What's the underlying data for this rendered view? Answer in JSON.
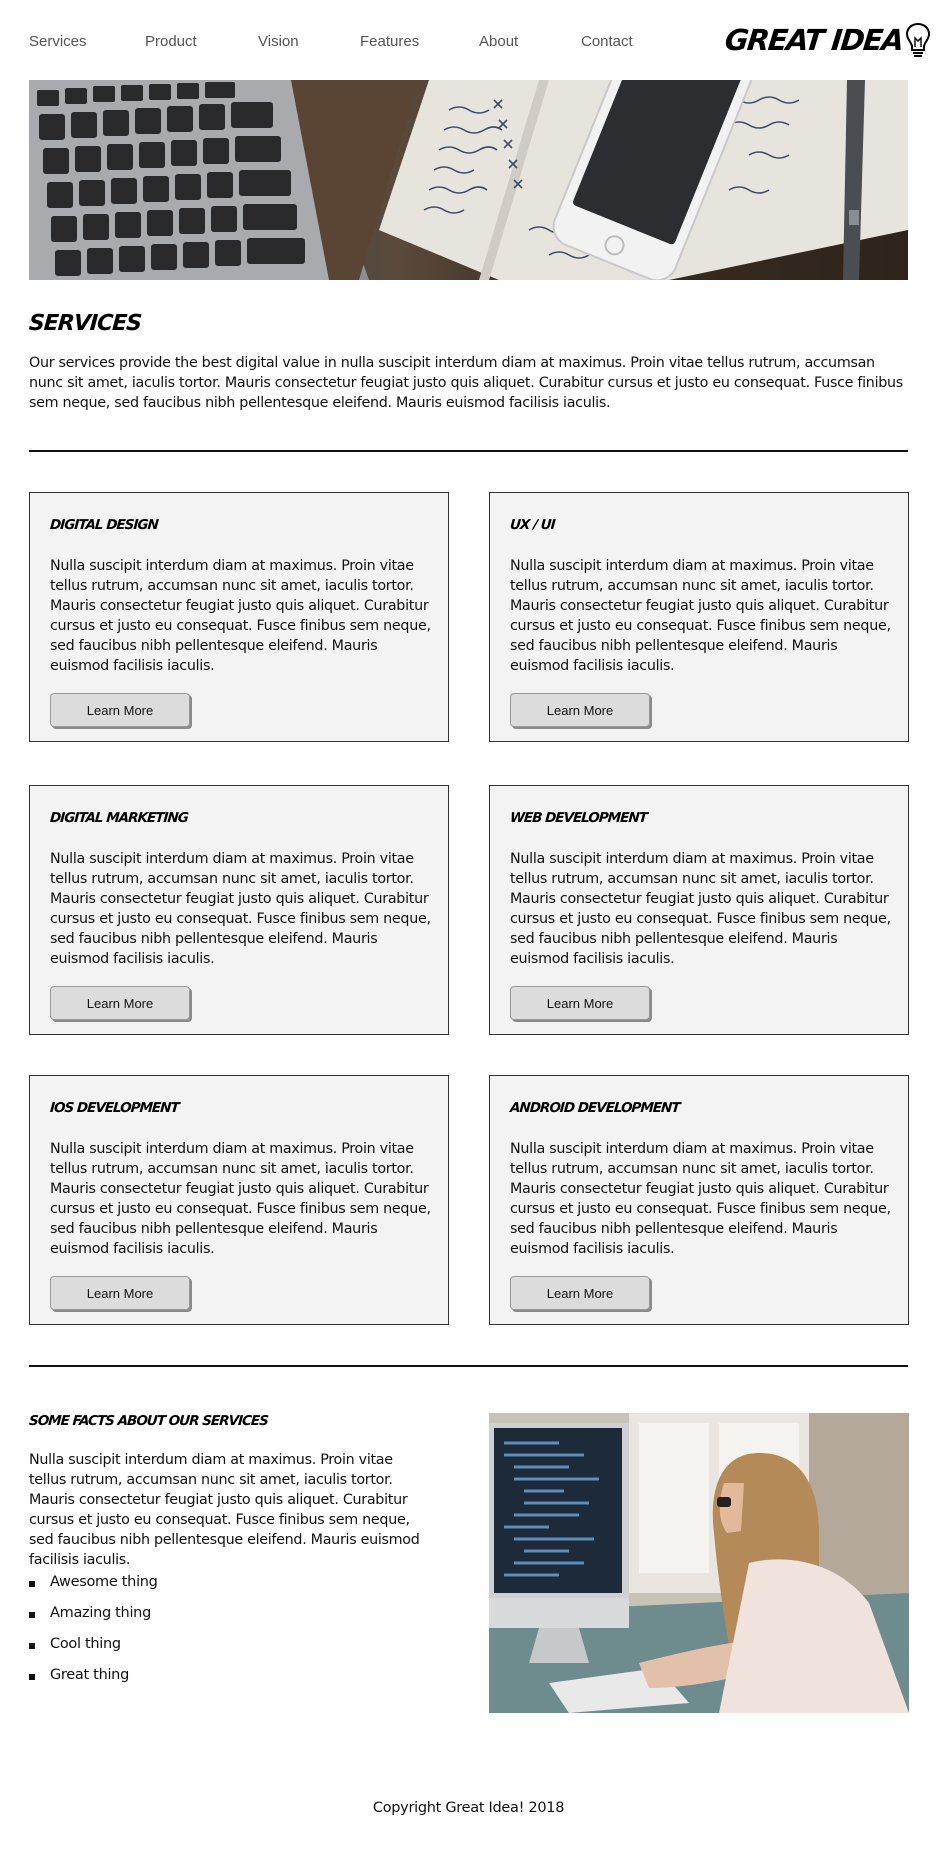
{
  "nav": {
    "links": [
      "Services",
      "Product",
      "Vision",
      "Features",
      "About",
      "Contact"
    ],
    "logo_text": "GREAT IDEA",
    "logo_icon": "lightbulb-icon"
  },
  "hero": {
    "image": "laptop-notebook-phone-desk-photo"
  },
  "services": {
    "title": "Services",
    "intro": "Our services provide the best digital value in nulla suscipit interdum diam at maximus. Proin vitae tellus rutrum, accumsan nunc sit amet, iaculis tortor. Mauris consectetur feugiat justo quis aliquet. Curabitur cursus et justo eu consequat. Fusce finibus sem neque, sed faucibus nibh pellentesque eleifend. Mauris euismod facilisis iaculis."
  },
  "cards": [
    {
      "title": "Digital Design",
      "text": "Nulla suscipit interdum diam at maximus. Proin vitae tellus rutrum, accumsan nunc sit amet, iaculis tortor. Mauris consectetur feugiat justo quis aliquet. Curabitur cursus et justo eu consequat. Fusce finibus sem neque, sed faucibus nibh pellentesque eleifend. Mauris euismod facilisis iaculis.",
      "button": "Learn More"
    },
    {
      "title": "UX / UI",
      "text": "Nulla suscipit interdum diam at maximus. Proin vitae tellus rutrum, accumsan nunc sit amet, iaculis tortor. Mauris consectetur feugiat justo quis aliquet. Curabitur cursus et justo eu consequat. Fusce finibus sem neque, sed faucibus nibh pellentesque eleifend. Mauris euismod facilisis iaculis.",
      "button": "Learn More"
    },
    {
      "title": "Digital Marketing",
      "text": "Nulla suscipit interdum diam at maximus. Proin vitae tellus rutrum, accumsan nunc sit amet, iaculis tortor. Mauris consectetur feugiat justo quis aliquet. Curabitur cursus et justo eu consequat. Fusce finibus sem neque, sed faucibus nibh pellentesque eleifend. Mauris euismod facilisis iaculis.",
      "button": "Learn More"
    },
    {
      "title": "Web Development",
      "text": "Nulla suscipit interdum diam at maximus. Proin vitae tellus rutrum, accumsan nunc sit amet, iaculis tortor. Mauris consectetur feugiat justo quis aliquet. Curabitur cursus et justo eu consequat. Fusce finibus sem neque, sed faucibus nibh pellentesque eleifend. Mauris euismod facilisis iaculis.",
      "button": "Learn More"
    },
    {
      "title": "IOS Development",
      "text": "Nulla suscipit interdum diam at maximus. Proin vitae tellus rutrum, accumsan nunc sit amet, iaculis tortor. Mauris consectetur feugiat justo quis aliquet. Curabitur cursus et justo eu consequat. Fusce finibus sem neque, sed faucibus nibh pellentesque eleifend. Mauris euismod facilisis iaculis.",
      "button": "Learn More"
    },
    {
      "title": "Android Development",
      "text": "Nulla suscipit interdum diam at maximus. Proin vitae tellus rutrum, accumsan nunc sit amet, iaculis tortor. Mauris consectetur feugiat justo quis aliquet. Curabitur cursus et justo eu consequat. Fusce finibus sem neque, sed faucibus nibh pellentesque eleifend. Mauris euismod facilisis iaculis.",
      "button": "Learn More"
    }
  ],
  "facts": {
    "title": "Some Facts About Our Services",
    "text": "Nulla suscipit interdum diam at maximus. Proin vitae tellus rutrum, accumsan nunc sit amet, iaculis tortor. Mauris consectetur feugiat justo quis aliquet. Curabitur cursus et justo eu consequat. Fusce finibus sem neque, sed faucibus nibh pellentesque eleifend. Mauris euismod facilisis iaculis.",
    "list": [
      "Awesome thing",
      "Amazing thing",
      "Cool thing",
      "Great thing"
    ],
    "image": "woman-coding-at-computer-photo"
  },
  "footer": {
    "copyright": "Copyright Great Idea! 2018"
  }
}
